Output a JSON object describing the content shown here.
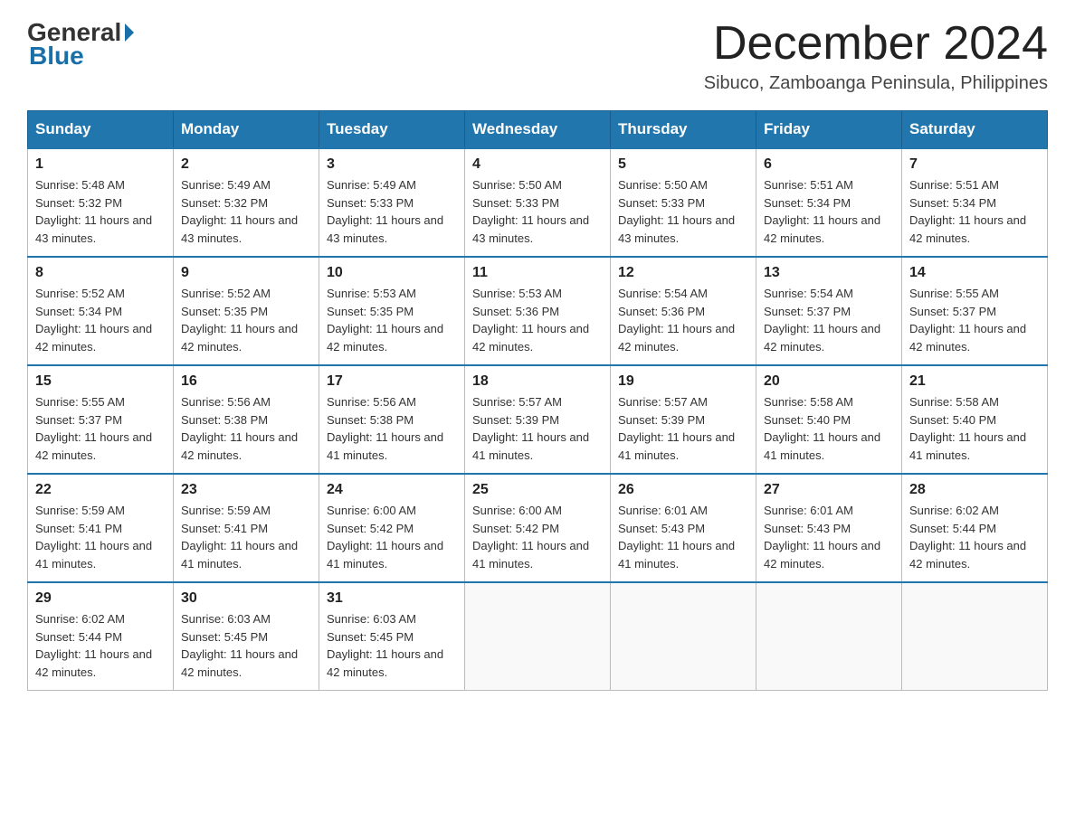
{
  "logo": {
    "general": "General",
    "blue": "Blue"
  },
  "title": "December 2024",
  "subtitle": "Sibuco, Zamboanga Peninsula, Philippines",
  "days_of_week": [
    "Sunday",
    "Monday",
    "Tuesday",
    "Wednesday",
    "Thursday",
    "Friday",
    "Saturday"
  ],
  "weeks": [
    [
      {
        "num": "1",
        "sunrise": "5:48 AM",
        "sunset": "5:32 PM",
        "daylight": "11 hours and 43 minutes."
      },
      {
        "num": "2",
        "sunrise": "5:49 AM",
        "sunset": "5:32 PM",
        "daylight": "11 hours and 43 minutes."
      },
      {
        "num": "3",
        "sunrise": "5:49 AM",
        "sunset": "5:33 PM",
        "daylight": "11 hours and 43 minutes."
      },
      {
        "num": "4",
        "sunrise": "5:50 AM",
        "sunset": "5:33 PM",
        "daylight": "11 hours and 43 minutes."
      },
      {
        "num": "5",
        "sunrise": "5:50 AM",
        "sunset": "5:33 PM",
        "daylight": "11 hours and 43 minutes."
      },
      {
        "num": "6",
        "sunrise": "5:51 AM",
        "sunset": "5:34 PM",
        "daylight": "11 hours and 42 minutes."
      },
      {
        "num": "7",
        "sunrise": "5:51 AM",
        "sunset": "5:34 PM",
        "daylight": "11 hours and 42 minutes."
      }
    ],
    [
      {
        "num": "8",
        "sunrise": "5:52 AM",
        "sunset": "5:34 PM",
        "daylight": "11 hours and 42 minutes."
      },
      {
        "num": "9",
        "sunrise": "5:52 AM",
        "sunset": "5:35 PM",
        "daylight": "11 hours and 42 minutes."
      },
      {
        "num": "10",
        "sunrise": "5:53 AM",
        "sunset": "5:35 PM",
        "daylight": "11 hours and 42 minutes."
      },
      {
        "num": "11",
        "sunrise": "5:53 AM",
        "sunset": "5:36 PM",
        "daylight": "11 hours and 42 minutes."
      },
      {
        "num": "12",
        "sunrise": "5:54 AM",
        "sunset": "5:36 PM",
        "daylight": "11 hours and 42 minutes."
      },
      {
        "num": "13",
        "sunrise": "5:54 AM",
        "sunset": "5:37 PM",
        "daylight": "11 hours and 42 minutes."
      },
      {
        "num": "14",
        "sunrise": "5:55 AM",
        "sunset": "5:37 PM",
        "daylight": "11 hours and 42 minutes."
      }
    ],
    [
      {
        "num": "15",
        "sunrise": "5:55 AM",
        "sunset": "5:37 PM",
        "daylight": "11 hours and 42 minutes."
      },
      {
        "num": "16",
        "sunrise": "5:56 AM",
        "sunset": "5:38 PM",
        "daylight": "11 hours and 42 minutes."
      },
      {
        "num": "17",
        "sunrise": "5:56 AM",
        "sunset": "5:38 PM",
        "daylight": "11 hours and 41 minutes."
      },
      {
        "num": "18",
        "sunrise": "5:57 AM",
        "sunset": "5:39 PM",
        "daylight": "11 hours and 41 minutes."
      },
      {
        "num": "19",
        "sunrise": "5:57 AM",
        "sunset": "5:39 PM",
        "daylight": "11 hours and 41 minutes."
      },
      {
        "num": "20",
        "sunrise": "5:58 AM",
        "sunset": "5:40 PM",
        "daylight": "11 hours and 41 minutes."
      },
      {
        "num": "21",
        "sunrise": "5:58 AM",
        "sunset": "5:40 PM",
        "daylight": "11 hours and 41 minutes."
      }
    ],
    [
      {
        "num": "22",
        "sunrise": "5:59 AM",
        "sunset": "5:41 PM",
        "daylight": "11 hours and 41 minutes."
      },
      {
        "num": "23",
        "sunrise": "5:59 AM",
        "sunset": "5:41 PM",
        "daylight": "11 hours and 41 minutes."
      },
      {
        "num": "24",
        "sunrise": "6:00 AM",
        "sunset": "5:42 PM",
        "daylight": "11 hours and 41 minutes."
      },
      {
        "num": "25",
        "sunrise": "6:00 AM",
        "sunset": "5:42 PM",
        "daylight": "11 hours and 41 minutes."
      },
      {
        "num": "26",
        "sunrise": "6:01 AM",
        "sunset": "5:43 PM",
        "daylight": "11 hours and 41 minutes."
      },
      {
        "num": "27",
        "sunrise": "6:01 AM",
        "sunset": "5:43 PM",
        "daylight": "11 hours and 42 minutes."
      },
      {
        "num": "28",
        "sunrise": "6:02 AM",
        "sunset": "5:44 PM",
        "daylight": "11 hours and 42 minutes."
      }
    ],
    [
      {
        "num": "29",
        "sunrise": "6:02 AM",
        "sunset": "5:44 PM",
        "daylight": "11 hours and 42 minutes."
      },
      {
        "num": "30",
        "sunrise": "6:03 AM",
        "sunset": "5:45 PM",
        "daylight": "11 hours and 42 minutes."
      },
      {
        "num": "31",
        "sunrise": "6:03 AM",
        "sunset": "5:45 PM",
        "daylight": "11 hours and 42 minutes."
      },
      null,
      null,
      null,
      null
    ]
  ],
  "labels": {
    "sunrise": "Sunrise: ",
    "sunset": "Sunset: ",
    "daylight": "Daylight: "
  }
}
